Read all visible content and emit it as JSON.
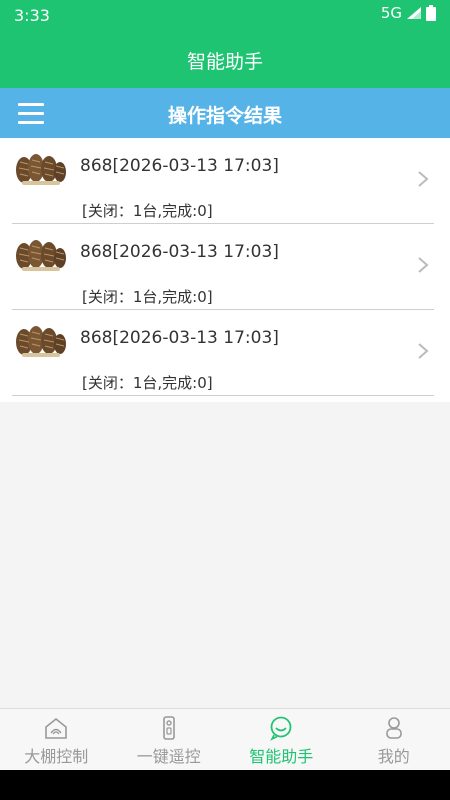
{
  "status_bar": {
    "time": "3:33",
    "network": "5G"
  },
  "app_bar": {
    "title": "智能助手"
  },
  "sub_bar": {
    "title": "操作指令结果"
  },
  "results": [
    {
      "title": "868[2026-03-13 17:03]",
      "summary": "[关闭：1台,完成:0]"
    },
    {
      "title": "868[2026-03-13 17:03]",
      "summary": "[关闭：1台,完成:0]"
    },
    {
      "title": "868[2026-03-13 17:03]",
      "summary": "[关闭：1台,完成:0]"
    }
  ],
  "bottom_nav": {
    "items": [
      {
        "label": "大棚控制",
        "icon": "greenhouse-icon"
      },
      {
        "label": "一键遥控",
        "icon": "remote-icon"
      },
      {
        "label": "智能助手",
        "icon": "assistant-icon"
      },
      {
        "label": "我的",
        "icon": "profile-icon"
      }
    ],
    "active_index": 2
  },
  "colors": {
    "primary_green": "#1fc472",
    "sub_bar_blue": "#56b3e8",
    "text": "#333333",
    "inactive_nav": "#999999"
  }
}
